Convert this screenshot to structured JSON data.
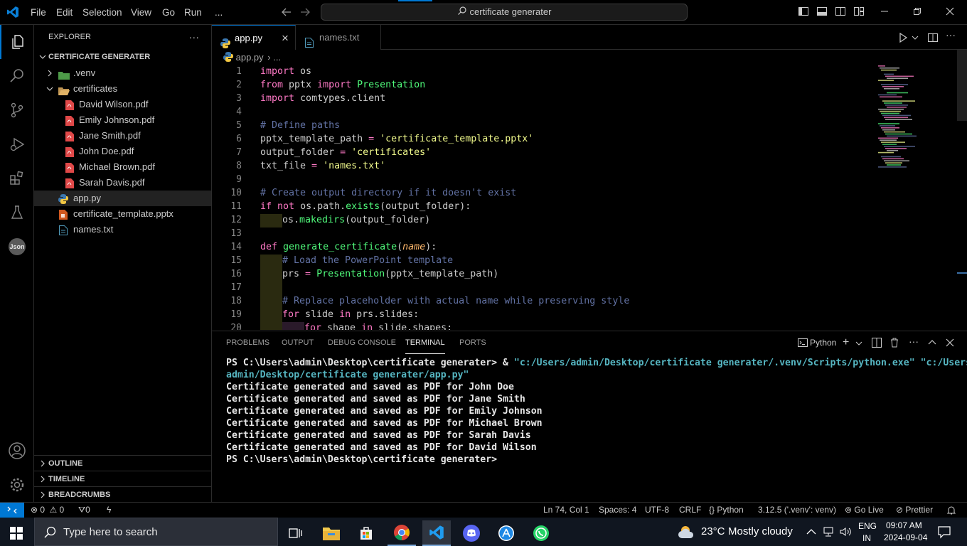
{
  "titlebar": {
    "menu": [
      "File",
      "Edit",
      "Selection",
      "View",
      "Go",
      "Run",
      "..."
    ],
    "search_text": "certificate generater"
  },
  "explorer": {
    "title": "EXPLORER",
    "more": "...",
    "root": "CERTIFICATE GENERATER",
    "items": [
      {
        "label": ".venv",
        "kind": "folder-collapsed"
      },
      {
        "label": "certificates",
        "kind": "folder-open"
      },
      {
        "label": "David Wilson.pdf",
        "kind": "pdf"
      },
      {
        "label": "Emily Johnson.pdf",
        "kind": "pdf"
      },
      {
        "label": "Jane Smith.pdf",
        "kind": "pdf"
      },
      {
        "label": "John Doe.pdf",
        "kind": "pdf"
      },
      {
        "label": "Michael Brown.pdf",
        "kind": "pdf"
      },
      {
        "label": "Sarah Davis.pdf",
        "kind": "pdf"
      },
      {
        "label": "app.py",
        "kind": "python",
        "selected": true
      },
      {
        "label": "certificate_template.pptx",
        "kind": "pptx"
      },
      {
        "label": "names.txt",
        "kind": "txt"
      }
    ],
    "sections": [
      "OUTLINE",
      "TIMELINE",
      "BREADCRUMBS"
    ]
  },
  "tabs": [
    {
      "label": "app.py",
      "active": true,
      "close": "×"
    },
    {
      "label": "names.txt",
      "active": false
    }
  ],
  "breadcrumb": {
    "file": "app.py",
    "rest": "..."
  },
  "code_lines": [
    "1",
    "2",
    "3",
    "4",
    "5",
    "6",
    "7",
    "8",
    "9",
    "10",
    "11",
    "12",
    "13",
    "14",
    "15",
    "16",
    "17",
    "18",
    "19",
    "20"
  ],
  "code": {
    "l1": [
      "import",
      " os"
    ],
    "l2": [
      "from",
      " pptx ",
      "import",
      " Presentation"
    ],
    "l3": [
      "import",
      " comtypes.client"
    ],
    "l5": "# Define paths",
    "l6": [
      "pptx_template_path",
      " = ",
      "'certificate_template.pptx'"
    ],
    "l7": [
      "output_folder",
      " = ",
      "'certificates'"
    ],
    "l8": [
      "txt_file",
      " = ",
      "'names.txt'"
    ],
    "l10": "# Create output directory if it doesn't exist",
    "l11": [
      "if",
      " ",
      "not",
      " os.path.",
      "exists",
      "(output_folder):"
    ],
    "l12": [
      "os.",
      "makedirs",
      "(output_folder)"
    ],
    "l14": [
      "def",
      " ",
      "generate_certificate",
      "(",
      "name",
      "):"
    ],
    "l15": "# Load the PowerPoint template",
    "l16": [
      "prs",
      " = ",
      "Presentation",
      "(pptx_template_path)"
    ],
    "l18": "# Replace placeholder with actual name while preserving style",
    "l19": [
      "for",
      " slide ",
      "in",
      " prs.slides:"
    ],
    "l20": [
      "for",
      " shape ",
      "in",
      " slide.shapes:"
    ]
  },
  "panel": {
    "tabs": [
      "PROBLEMS",
      "OUTPUT",
      "DEBUG CONSOLE",
      "TERMINAL",
      "PORTS"
    ],
    "active_tab": "TERMINAL",
    "shell": "Python",
    "lines": [
      {
        "prefix": "PS C:\\Users\\admin\\Desktop\\certificate generater> & ",
        "cmd": "\"c:/Users/admin/Desktop/certificate generater/.venv/Scripts/python.exe\" \"c:/Users/"
      },
      {
        "prefix": "",
        "cmd": "admin/Desktop/certificate generater/app.py\""
      },
      {
        "prefix": "Certificate generated and saved as PDF for John Doe",
        "cmd": ""
      },
      {
        "prefix": "Certificate generated and saved as PDF for Jane Smith",
        "cmd": ""
      },
      {
        "prefix": "Certificate generated and saved as PDF for Emily Johnson",
        "cmd": ""
      },
      {
        "prefix": "Certificate generated and saved as PDF for Michael Brown",
        "cmd": ""
      },
      {
        "prefix": "Certificate generated and saved as PDF for Sarah Davis",
        "cmd": ""
      },
      {
        "prefix": "Certificate generated and saved as PDF for David Wilson",
        "cmd": ""
      },
      {
        "prefix": "PS C:\\Users\\admin\\Desktop\\certificate generater>",
        "cmd": ""
      }
    ]
  },
  "status": {
    "errors": "0",
    "warnings": "0",
    "ports": "0",
    "position": "Ln 74, Col 1",
    "spaces": "Spaces: 4",
    "encoding": "UTF-8",
    "eol": "CRLF",
    "language": "Python",
    "interpreter": "3.12.5 ('.venv': venv)",
    "golive": "Go Live",
    "prettier": "Prettier"
  },
  "taskbar": {
    "search_placeholder": "Type here to search",
    "weather_temp": "23°C",
    "weather_text": "Mostly cloudy",
    "lang1": "ENG",
    "lang2": "IN",
    "time": "09:07 AM",
    "date": "2024-09-04"
  },
  "colors": {
    "accent": "#0078d4",
    "status_remote": "#0078d4"
  }
}
